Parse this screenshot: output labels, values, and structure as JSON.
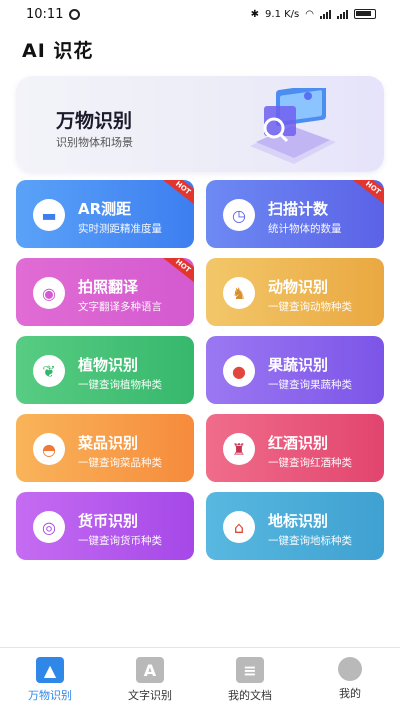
{
  "status_bar": {
    "time": "10:11",
    "net_speed": "9.1 K/s",
    "net_type": "4G",
    "battery": ""
  },
  "app": {
    "title": "AI 识花"
  },
  "banner": {
    "title": "万物识别",
    "subtitle": "识别物体和场景"
  },
  "hot_badge": "HOT",
  "features": [
    {
      "title": "AR测距",
      "subtitle": "实时测距精准度量",
      "icon": "ruler-icon",
      "hot": true,
      "colors": [
        "#5aa2f8",
        "#3d7ef0"
      ]
    },
    {
      "title": "扫描计数",
      "subtitle": "统计物体的数量",
      "icon": "timer-icon",
      "hot": true,
      "colors": [
        "#6d8af3",
        "#5b62e6"
      ]
    },
    {
      "title": "拍照翻译",
      "subtitle": "文字翻译多种语言",
      "icon": "camera-icon",
      "hot": true,
      "colors": [
        "#e16cd4",
        "#d35ad0"
      ]
    },
    {
      "title": "动物识别",
      "subtitle": "一键查询动物种类",
      "icon": "dog-icon",
      "hot": false,
      "colors": [
        "#f2c769",
        "#eaa841"
      ]
    },
    {
      "title": "植物识别",
      "subtitle": "一键查询植物种类",
      "icon": "sprout-icon",
      "hot": false,
      "colors": [
        "#58cc83",
        "#36b86c"
      ]
    },
    {
      "title": "果蔬识别",
      "subtitle": "一键查询果蔬种类",
      "icon": "apple-icon",
      "hot": false,
      "colors": [
        "#9b78f2",
        "#7c55e8"
      ]
    },
    {
      "title": "菜品识别",
      "subtitle": "一键查询菜品种类",
      "icon": "dish-icon",
      "hot": false,
      "colors": [
        "#f9b45a",
        "#f68b3c"
      ]
    },
    {
      "title": "红酒识别",
      "subtitle": "一键查询红酒种类",
      "icon": "wine-icon",
      "hot": false,
      "colors": [
        "#f06c8a",
        "#e2456f"
      ]
    },
    {
      "title": "货币识别",
      "subtitle": "一键查询货币种类",
      "icon": "coins-icon",
      "hot": false,
      "colors": [
        "#c56cf2",
        "#a548e8"
      ]
    },
    {
      "title": "地标识别",
      "subtitle": "一键查询地标种类",
      "icon": "temple-icon",
      "hot": false,
      "colors": [
        "#58b8e0",
        "#3fa1d1"
      ]
    }
  ],
  "tabs": [
    {
      "label": "万物识别",
      "icon": "image-icon",
      "active": true
    },
    {
      "label": "文字识别",
      "icon": "text-a-icon",
      "active": false
    },
    {
      "label": "我的文档",
      "icon": "document-icon",
      "active": false
    },
    {
      "label": "我的",
      "icon": "user-icon",
      "active": false
    }
  ],
  "theme": {
    "accent": "#2f87e8",
    "hot": "#e2352f"
  }
}
